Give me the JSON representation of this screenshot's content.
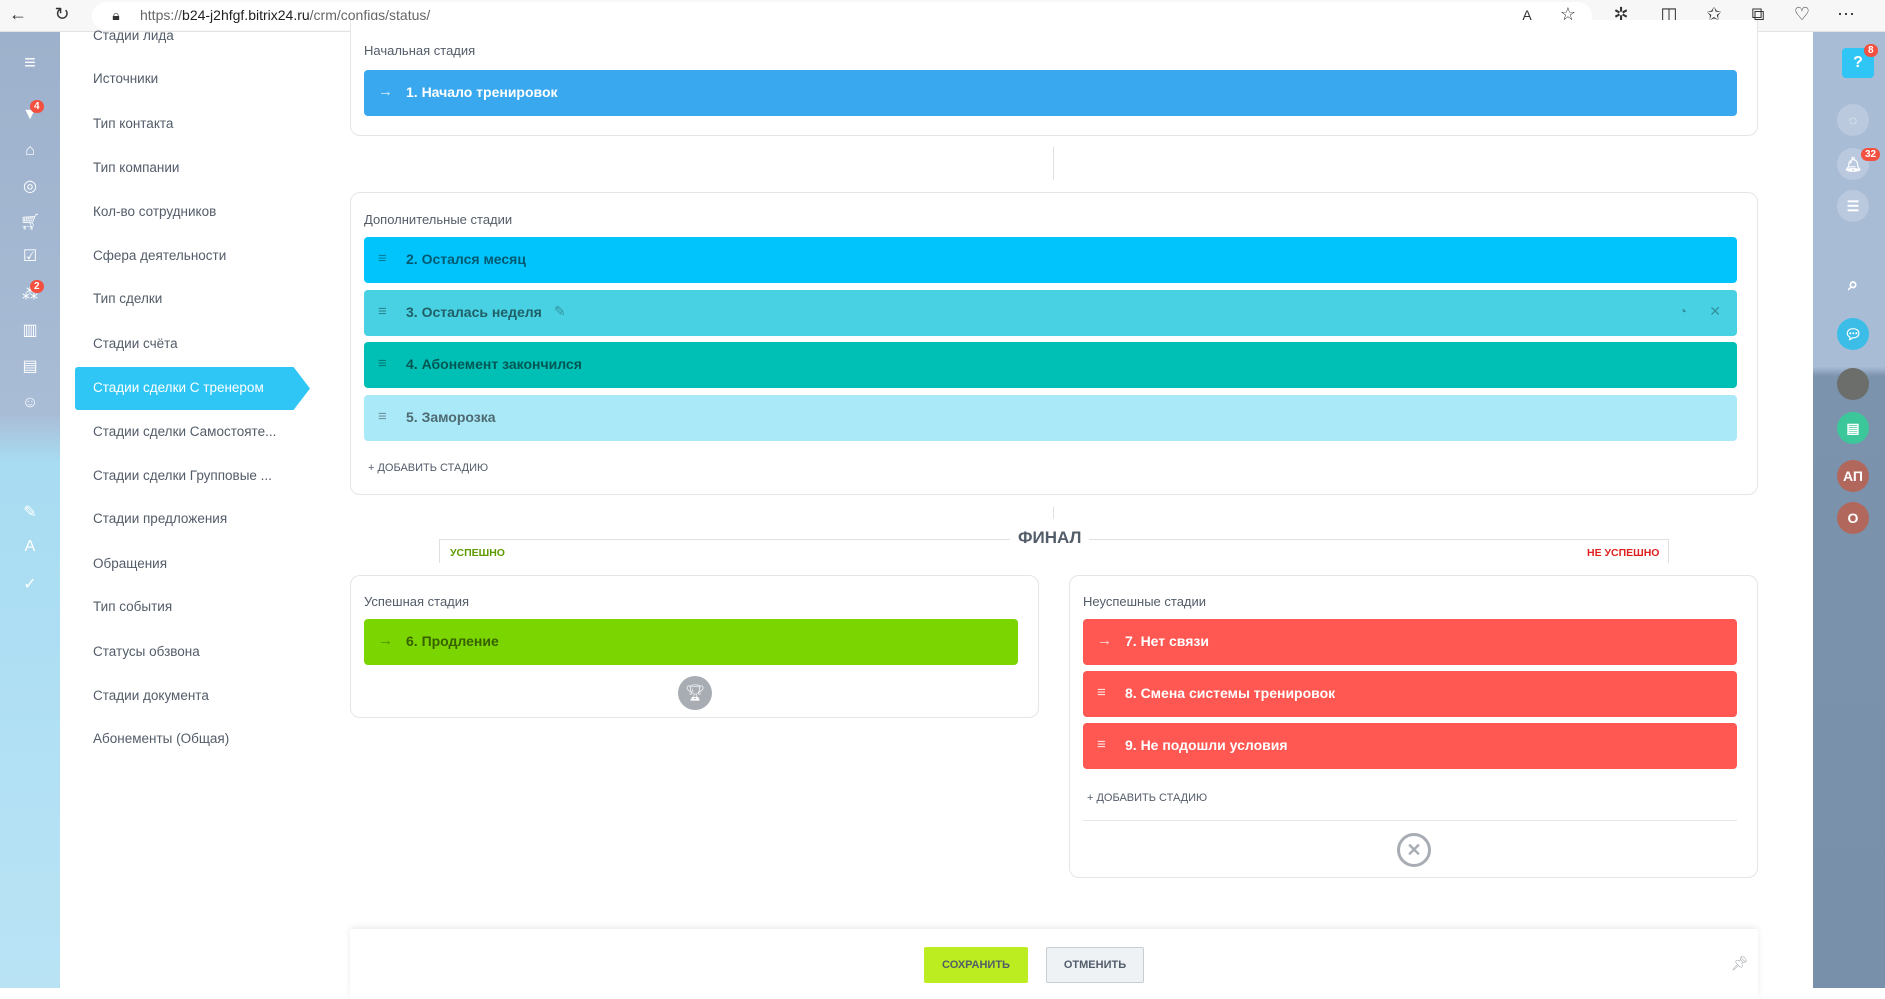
{
  "browser": {
    "url_prefix": "https://",
    "url_host": "b24-j2hfgf.bitrix24.ru",
    "url_path": "/crm/configs/status/"
  },
  "left_bar": {
    "badges": [
      "4",
      "2"
    ]
  },
  "nav": {
    "items": [
      "Стадии лида",
      "Источники",
      "Тип контакта",
      "Тип компании",
      "Кол-во сотрудников",
      "Сфера деятельности",
      "Тип сделки",
      "Стадии счёта",
      "Стадии сделки С тренером",
      "Стадии сделки Самостояте...",
      "Стадии сделки Групповые ...",
      "Стадии предложения",
      "Обращения",
      "Тип события",
      "Статусы обзвона",
      "Стадии документа",
      "Абонементы (Общая)"
    ],
    "active_index": 8
  },
  "initial": {
    "label": "Начальная стадия",
    "stage": {
      "name": "1. Начало тренировок",
      "color": "#39a8ef"
    }
  },
  "extra": {
    "label": "Дополнительные стадии",
    "stages": [
      {
        "name": "2. Остался месяц",
        "color": "#00c4fb"
      },
      {
        "name": "3. Осталась неделя",
        "color": "#47d1e2"
      },
      {
        "name": "4. Абонемент закончился",
        "color": "#00bfb5"
      },
      {
        "name": "5. Заморозка",
        "color": "#aae9f8"
      }
    ],
    "add_label": "+ Добавить стадию"
  },
  "final": {
    "title": "ФИНАЛ",
    "success_tag": "УСПЕШНО",
    "fail_tag": "НЕ УСПЕШНО"
  },
  "success": {
    "label": "Успешная стадия",
    "stage": {
      "name": "6. Продление",
      "color": "#7bd500"
    }
  },
  "fail": {
    "label": "Неуспешные стадии",
    "stages": [
      {
        "name": "7. Нет связи",
        "color": "#ff5752"
      },
      {
        "name": "8. Смена системы тренировок",
        "color": "#ff5752"
      },
      {
        "name": "9. Не подошли условия",
        "color": "#ff5752"
      }
    ],
    "add_label": "+ Добавить стадию"
  },
  "footer": {
    "save": "Сохранить",
    "cancel": "Отменить"
  },
  "right_bar": {
    "help_badge": "8",
    "notif_badge": "32",
    "avatar1": "АП",
    "avatar2": "О"
  }
}
